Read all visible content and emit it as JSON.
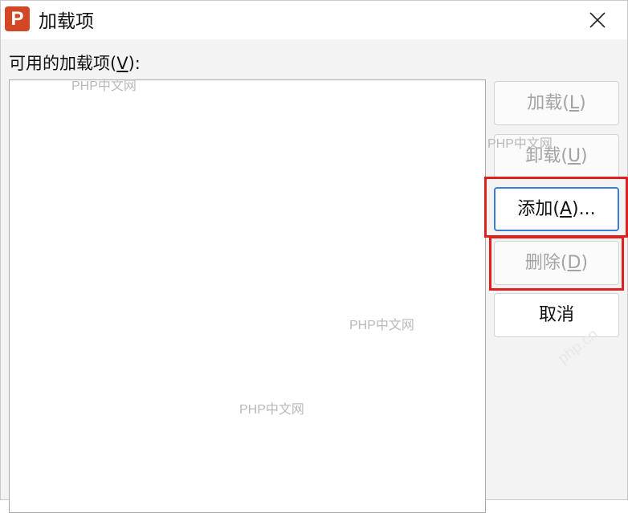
{
  "window": {
    "title": "加载项",
    "app_icon_letter": "P",
    "app_icon_color": "#d24726"
  },
  "list": {
    "label": "可用的加载项(",
    "label_mnemonic": "V",
    "label_suffix": "):",
    "items": []
  },
  "buttons": {
    "load": {
      "label": "加载(",
      "mnemonic": "L",
      "suffix": ")",
      "enabled": false
    },
    "unload": {
      "label": "卸载(",
      "mnemonic": "U",
      "suffix": ")",
      "enabled": false
    },
    "add": {
      "label": "添加(",
      "mnemonic": "A",
      "suffix": ")...",
      "enabled": true
    },
    "remove": {
      "label": "删除(",
      "mnemonic": "D",
      "suffix": ")",
      "enabled": false
    },
    "cancel": {
      "label": "取消",
      "enabled": true
    }
  },
  "highlight_color": "#e02020",
  "watermarks": [
    "PHP中文网",
    "PHP中文网",
    "PHP中文网",
    "PHP中文网",
    "php.cn"
  ]
}
